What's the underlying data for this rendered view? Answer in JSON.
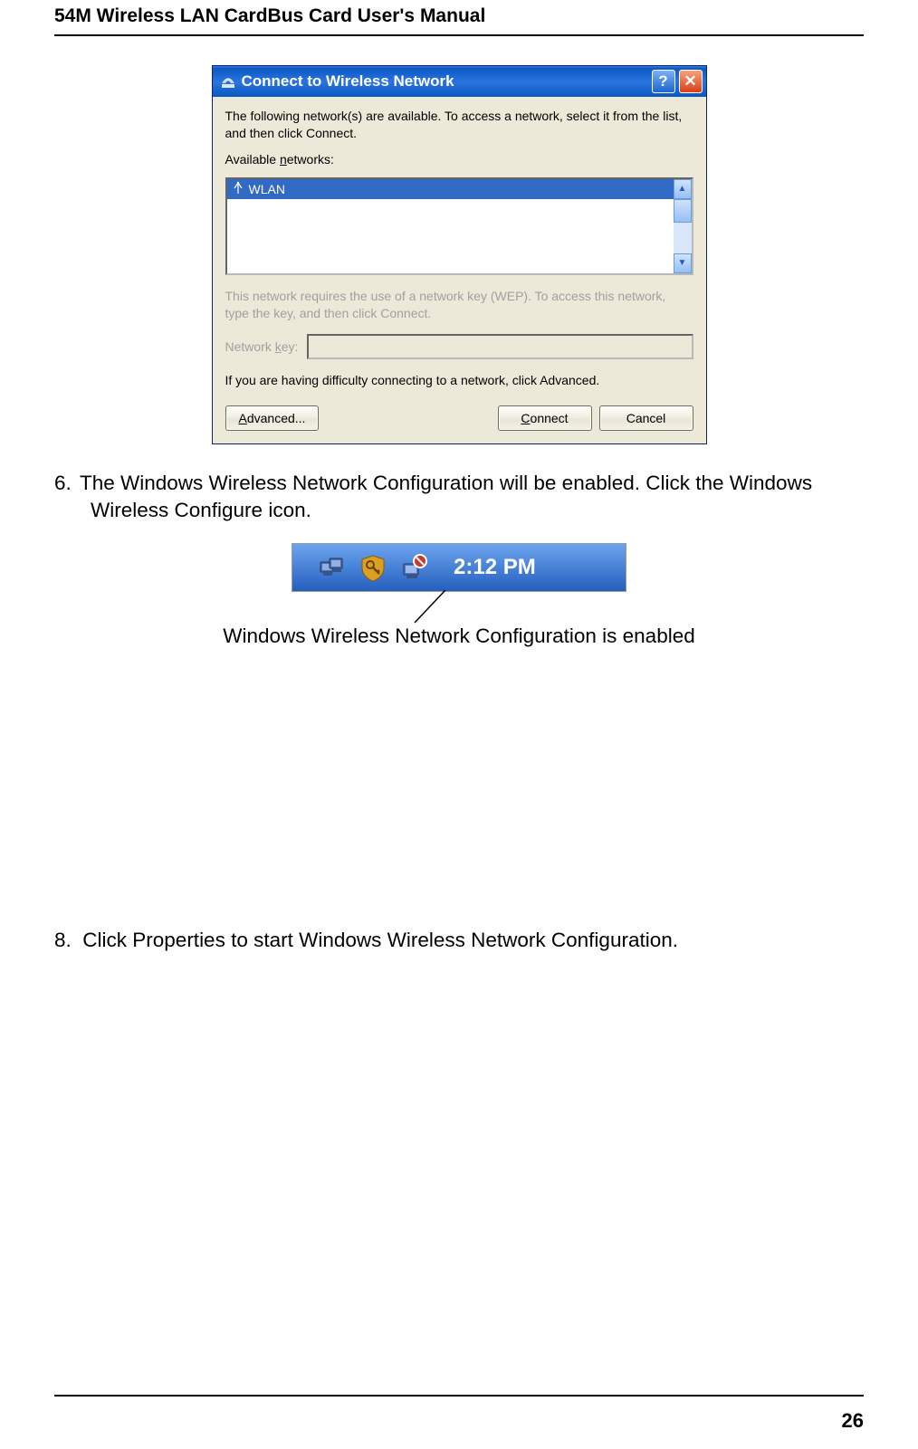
{
  "header": "54M Wireless LAN CardBus Card User's Manual",
  "page_number": "26",
  "dialog": {
    "title": "Connect to Wireless Network",
    "intro": "The following network(s) are available. To access a network, select it from the list, and then click Connect.",
    "available_label_pre": "Available ",
    "available_label_u": "n",
    "available_label_post": "etworks:",
    "network_item": "WLAN",
    "wep_text": "This network requires the use of a network key (WEP). To access this network, type the key, and then click Connect.",
    "key_label_pre": "Network ",
    "key_label_u": "k",
    "key_label_post": "ey:",
    "difficulty_text": "If you are having difficulty connecting to a network, click Advanced.",
    "advanced_u": "A",
    "advanced_rest": "dvanced...",
    "connect_u": "C",
    "connect_rest": "onnect",
    "cancel": "Cancel"
  },
  "step6_num": "6.",
  "step6_text_a": "The Windows Wireless Network Configuration will be enabled. Click the Windows",
  "step6_text_b": "Wireless Configure icon.",
  "tray_time": "2:12 PM",
  "caption": "Windows Wireless Network Configuration is enabled",
  "step8_num": "8.",
  "step8_text": "Click Properties to start Windows Wireless Network Configuration."
}
